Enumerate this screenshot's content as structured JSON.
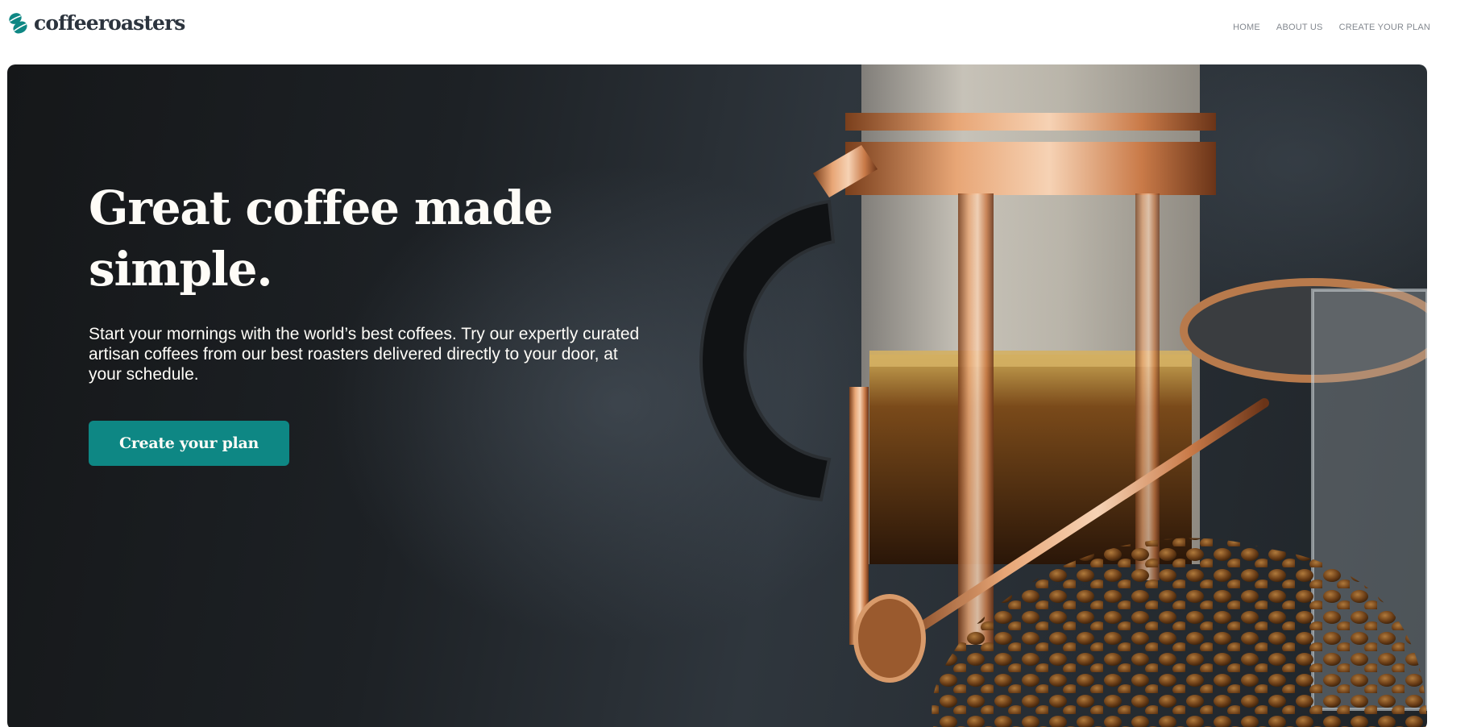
{
  "brand": {
    "name": "coffeeroasters",
    "accent_color": "#0e8784",
    "text_color": "#2c343e",
    "logo_icon": "coffee-bean-icon"
  },
  "nav": {
    "items": [
      {
        "label": "HOME"
      },
      {
        "label": "ABOUT US"
      },
      {
        "label": "CREATE YOUR PLAN"
      }
    ]
  },
  "hero": {
    "title": "Great coffee made simple.",
    "description": "Start your mornings with the world’s best coffees. Try our expertly curated artisan coffees from our best roasters delivered directly to your door, at your schedule.",
    "cta_label": "Create your plan",
    "image_subject": "french-press-coffee-image",
    "overlay_text_color": "#fefcf7"
  }
}
